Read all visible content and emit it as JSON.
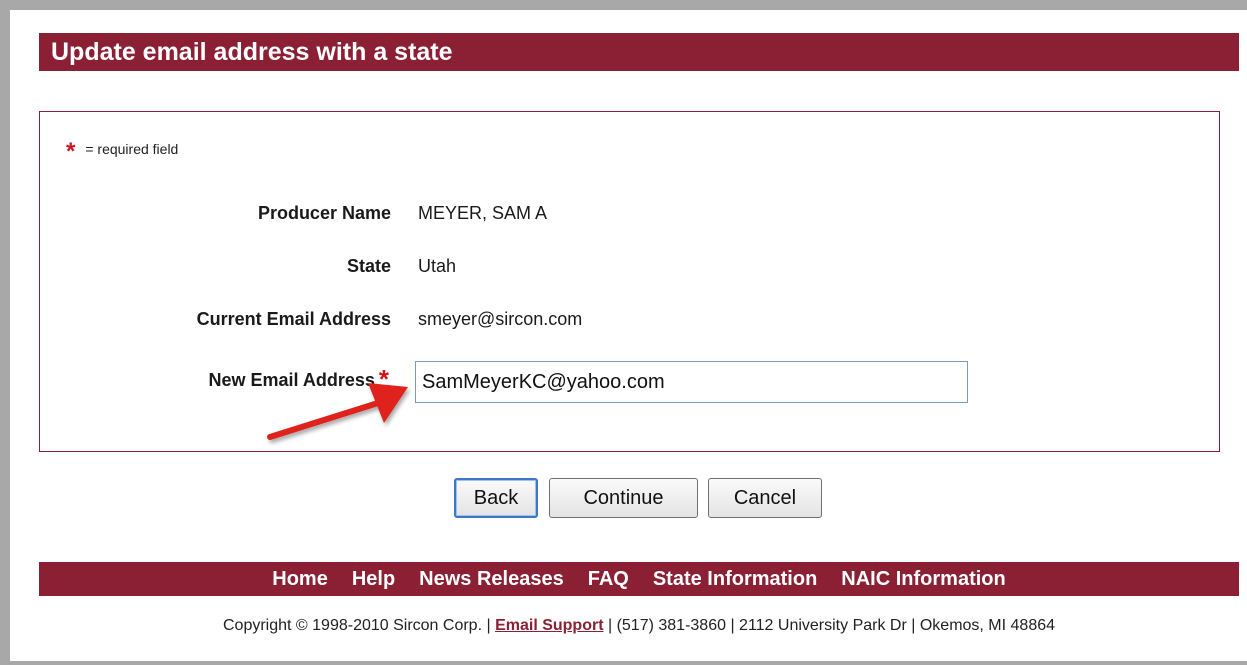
{
  "page": {
    "title": "Update email address with a state"
  },
  "form": {
    "required_note": "= required field",
    "producer_name_label": "Producer Name",
    "producer_name_value": "MEYER, SAM A",
    "state_label": "State",
    "state_value": "Utah",
    "current_email_label": "Current Email Address",
    "current_email_value": "smeyer@sircon.com",
    "new_email_label": "New Email Address",
    "new_email_value": "SamMeyerKC@yahoo.com"
  },
  "buttons": {
    "back": "Back",
    "continue": "Continue",
    "cancel": "Cancel"
  },
  "footer": {
    "nav": [
      "Home",
      "Help",
      "News Releases",
      "FAQ",
      "State Information",
      "NAIC Information"
    ],
    "copyright_prefix": "Copyright © 1998-2010 Sircon Corp. | ",
    "email_support": "Email Support",
    "copyright_suffix": " | (517) 381-3860 | 2112 University Park Dr | Okemos, MI 48864"
  },
  "colors": {
    "brand": "#8b2035",
    "required_star": "#d1121b",
    "annotation_arrow": "#e0201c"
  },
  "icons": {
    "required": "asterisk-icon",
    "annotation": "red-arrow-icon"
  }
}
